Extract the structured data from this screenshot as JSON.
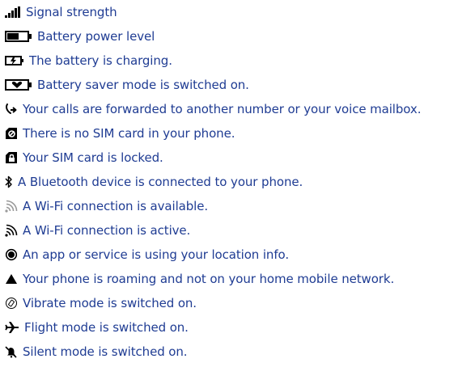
{
  "accent_color": "#1f3c93",
  "icon_color": "#000000",
  "items": [
    {
      "icon": "signal-strength-icon",
      "text": "Signal strength"
    },
    {
      "icon": "battery-level-icon",
      "text": "Battery power level"
    },
    {
      "icon": "battery-charging-icon",
      "text": "The battery is charging."
    },
    {
      "icon": "battery-saver-icon",
      "text": "Battery saver mode is switched on."
    },
    {
      "icon": "call-forward-icon",
      "text": "Your calls are forwarded to another number or your voice mailbox."
    },
    {
      "icon": "no-sim-icon",
      "text": "There is no SIM card in your phone."
    },
    {
      "icon": "sim-locked-icon",
      "text": "Your SIM card is locked."
    },
    {
      "icon": "bluetooth-icon",
      "text": "A Bluetooth device is connected to your phone."
    },
    {
      "icon": "wifi-available-icon",
      "text": "A Wi-Fi connection is available."
    },
    {
      "icon": "wifi-active-icon",
      "text": "A Wi-Fi connection is active."
    },
    {
      "icon": "location-icon",
      "text": "An app or service is using your location info."
    },
    {
      "icon": "roaming-icon",
      "text": "Your phone is roaming and not on your home mobile network."
    },
    {
      "icon": "vibrate-icon",
      "text": "Vibrate mode is switched on."
    },
    {
      "icon": "flight-mode-icon",
      "text": "Flight mode is switched on."
    },
    {
      "icon": "silent-mode-icon",
      "text": "Silent mode is switched on."
    }
  ]
}
